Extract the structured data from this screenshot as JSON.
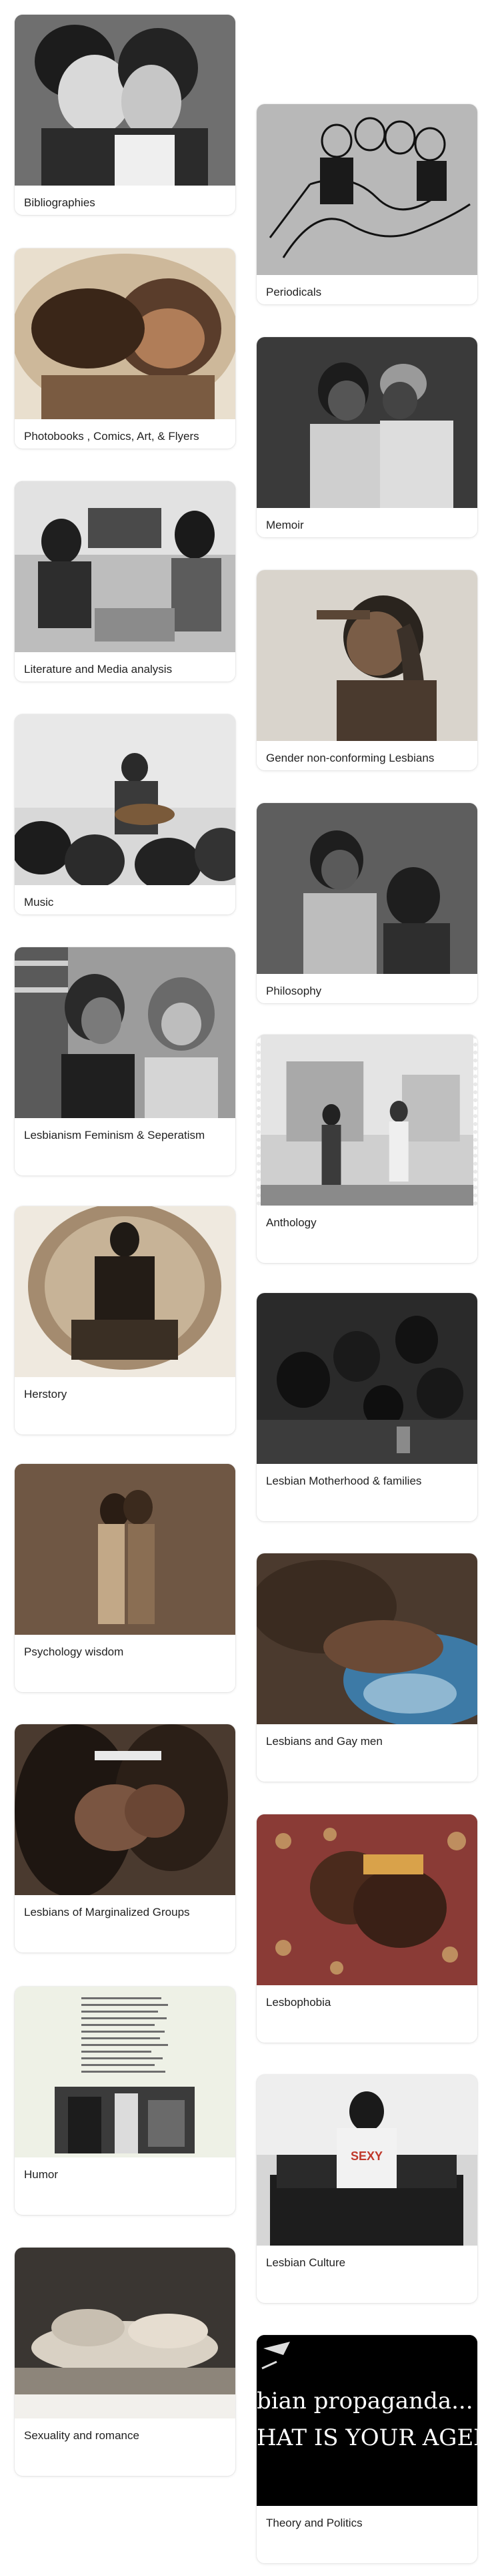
{
  "cards": [
    {
      "label": "Bibliographies"
    },
    {
      "label": "Periodicals"
    },
    {
      "label": "Photobooks , Comics, Art, & Flyers"
    },
    {
      "label": "Memoir"
    },
    {
      "label": "Literature and Media analysis"
    },
    {
      "label": "Gender non-conforming Lesbians"
    },
    {
      "label": "Music"
    },
    {
      "label": "Philosophy"
    },
    {
      "label": "Lesbianism Feminism & Seperatism"
    },
    {
      "label": "Anthology"
    },
    {
      "label": "Herstory"
    },
    {
      "label": "Lesbian Motherhood & families"
    },
    {
      "label": "Psychology wisdom"
    },
    {
      "label": "Lesbians and Gay men"
    },
    {
      "label": "Lesbians of Marginalized Groups"
    },
    {
      "label": "Lesbophobia"
    },
    {
      "label": "Humor"
    },
    {
      "label": "Lesbian Culture"
    },
    {
      "label": "Sexuality and romance"
    },
    {
      "label": "Theory and Politics"
    }
  ],
  "theory_banner": {
    "line1": "bian propaganda...",
    "line2": "HAT IS YOUR AGEND"
  },
  "culture_shirt_text": "SEXY",
  "colors": {
    "card_border": "#e6e6e6",
    "label_text": "#222222",
    "page_bg": "#ffffff"
  }
}
